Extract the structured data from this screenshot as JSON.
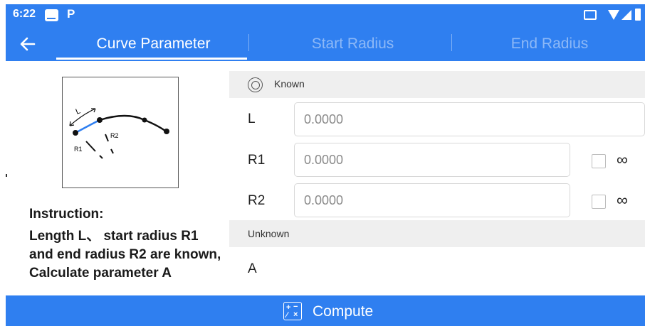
{
  "status_bar": {
    "time": "6:22",
    "left_icons": [
      "gallery-icon",
      "parking-icon"
    ],
    "right_icons": [
      "cast-icon",
      "wifi-icon",
      "signal-icon",
      "battery-icon"
    ],
    "p_glyph": "P"
  },
  "nav": {
    "back_icon": "back-arrow-icon",
    "tabs": [
      {
        "label": "Curve Parameter",
        "active": true
      },
      {
        "label": "Start Radius",
        "active": false
      },
      {
        "label": "End Radius",
        "active": false
      }
    ]
  },
  "diagram": {
    "label_L": "L",
    "label_R1": "R1",
    "label_R2": "R2"
  },
  "instruction": {
    "title": "Instruction:",
    "text": " Length L、 start radius R1 and end radius R2 are known, Calculate parameter A"
  },
  "known": {
    "header": "Known",
    "icon": "target-icon",
    "rows": [
      {
        "label": "L",
        "placeholder": "0.0000",
        "has_infinity": false
      },
      {
        "label": "R1",
        "placeholder": "0.0000",
        "has_infinity": true,
        "infinity_symbol": "∞"
      },
      {
        "label": "R2",
        "placeholder": "0.0000",
        "has_infinity": true,
        "infinity_symbol": "∞"
      }
    ]
  },
  "unknown": {
    "header": "Unknown",
    "rows": [
      {
        "label": "A"
      }
    ]
  },
  "compute": {
    "label": "Compute",
    "icon": "calculator-icon"
  },
  "colors": {
    "primary": "#2f7ff0",
    "section_bg": "#efefef",
    "curve_blue": "#2f7ff0"
  }
}
